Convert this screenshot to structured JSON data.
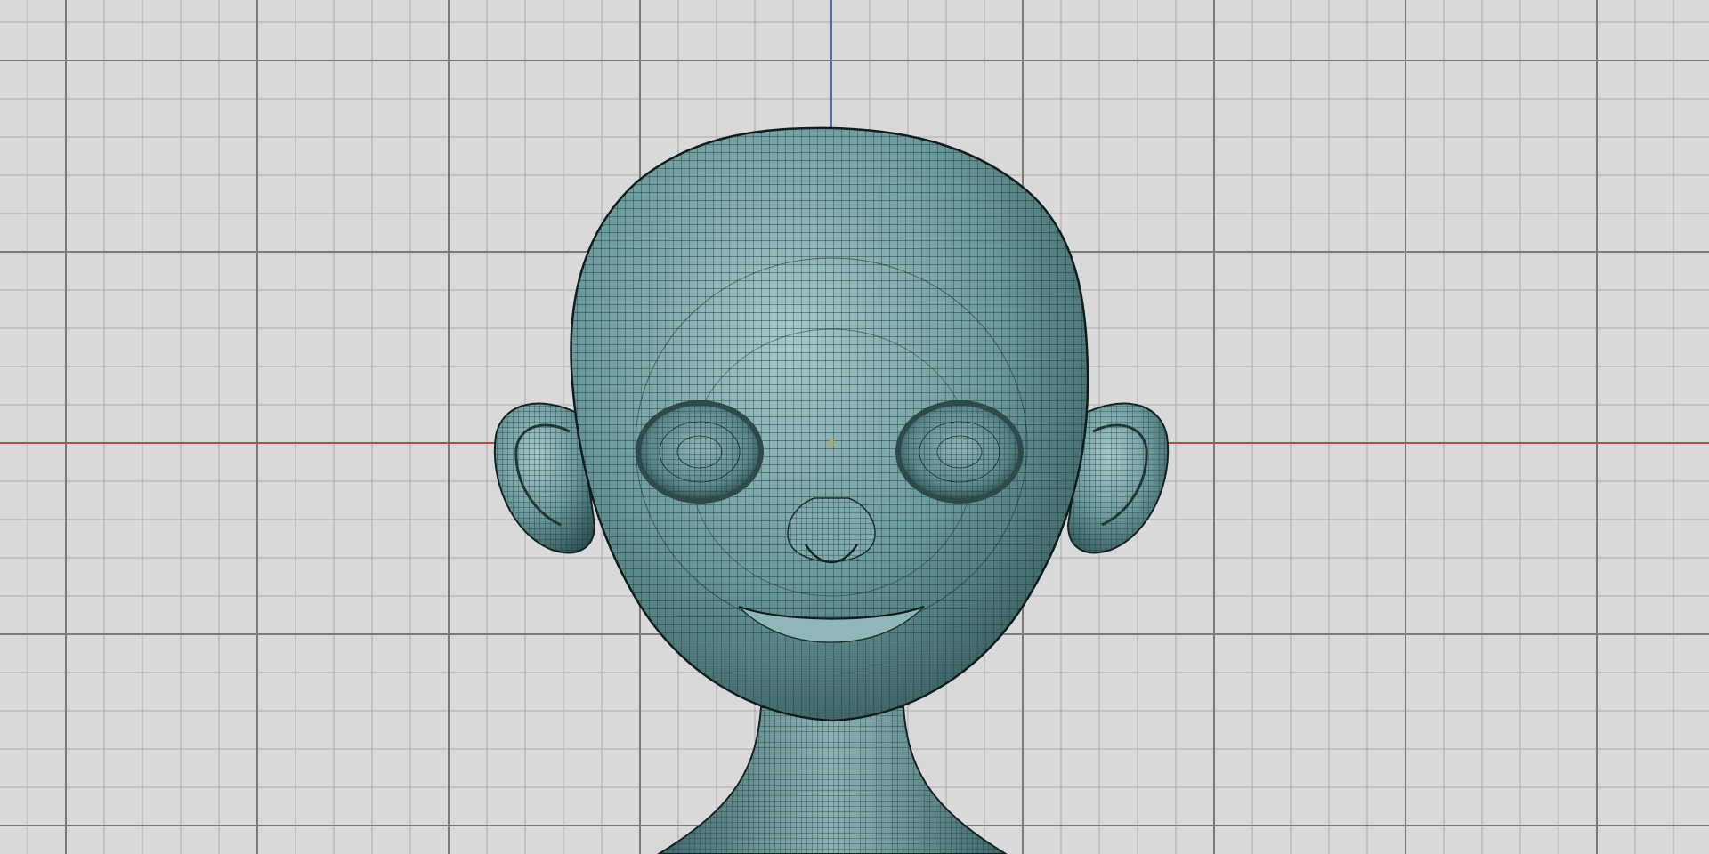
{
  "viewport": {
    "view": "front-orthographic",
    "shading": "wireframe-on-shaded",
    "grid": {
      "visible": true
    },
    "axes": {
      "x_axis_color": "#cc3333",
      "z_axis_color": "#3366cc"
    },
    "colors": {
      "background": "#d9d9d9",
      "grid_minor": "#a9a9a9",
      "grid_major": "#7a7a7a",
      "mesh_fill": "#6a9a9c",
      "mesh_highlight": "#a6c8ca",
      "mesh_shadow": "#2f5457",
      "wire": "#1c2d2e",
      "origin_marker": "#d8a020"
    }
  },
  "model": {
    "type": "character-head-sculpt",
    "features": [
      "head",
      "left-ear",
      "right-ear",
      "left-eye-socket",
      "right-eye-socket",
      "nose",
      "mouth",
      "neck"
    ]
  }
}
